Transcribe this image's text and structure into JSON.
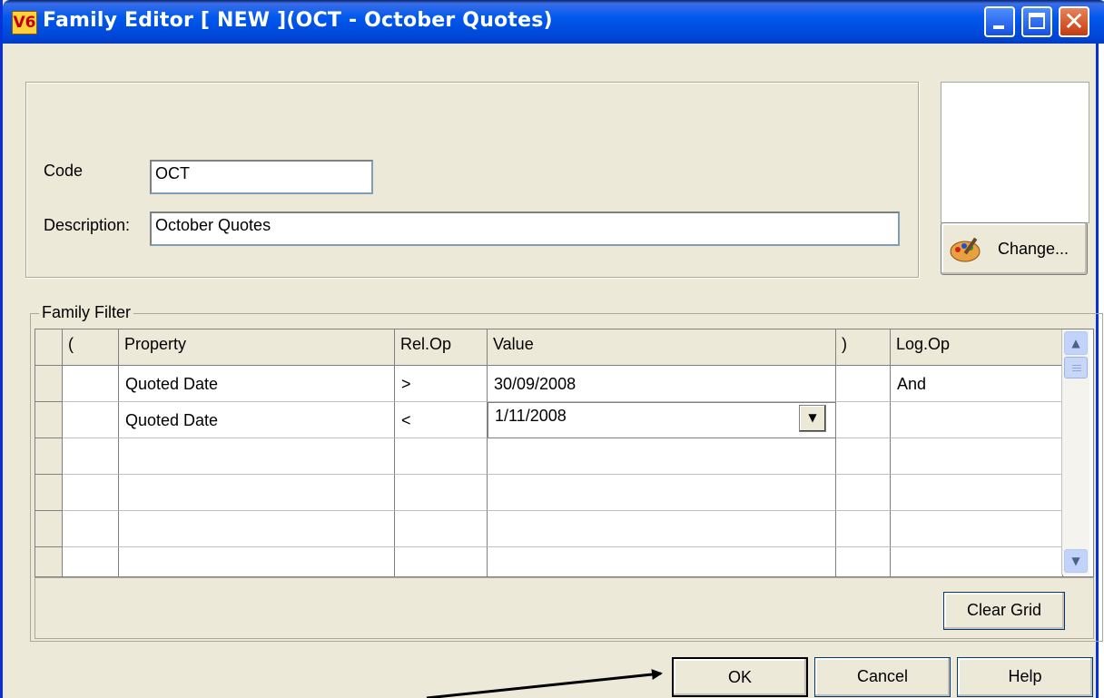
{
  "window": {
    "title": "Family Editor  [ NEW ](OCT - October Quotes)",
    "app_icon_text": "V6",
    "close_glyph": "✕"
  },
  "form": {
    "code_label": "Code",
    "code_value": "OCT",
    "description_label": "Description:",
    "description_value": "October Quotes",
    "change_button": "Change..."
  },
  "filter": {
    "group_label": "Family Filter",
    "columns": [
      "(",
      "Property",
      "Rel.Op",
      "Value",
      ")",
      "Log.Op"
    ],
    "rows": [
      {
        "open": "",
        "property": "Quoted Date",
        "relop": ">",
        "value": "30/09/2008",
        "close": "",
        "logop": "And"
      },
      {
        "open": "",
        "property": "Quoted Date",
        "relop": "<",
        "value": "1/11/2008",
        "close": "",
        "logop": ""
      }
    ],
    "empty_rows": 4,
    "clear_button": "Clear Grid"
  },
  "buttons": {
    "ok": "OK",
    "cancel": "Cancel",
    "help": "Help"
  },
  "colors": {
    "titlebar": "#0058EE",
    "dialog_bg": "#ECE9D8",
    "close_button": "#E0612F"
  },
  "icons": [
    "app-icon",
    "minimize-icon",
    "maximize-icon",
    "close-icon",
    "palette-icon",
    "dropdown-arrow-icon",
    "scroll-up-icon",
    "scroll-down-icon"
  ]
}
